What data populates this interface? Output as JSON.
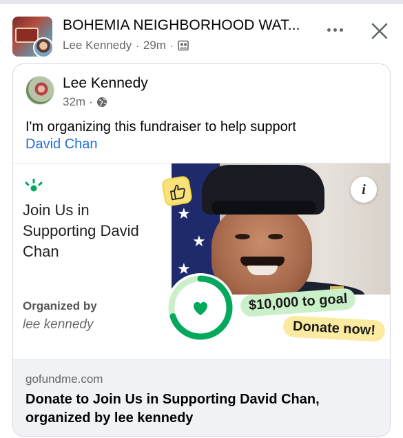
{
  "post": {
    "group_name": "BOHEMIA NEIGHBORHOOD WAT...",
    "poster": "Lee Kennedy",
    "time": "29m",
    "separator": "·"
  },
  "shared": {
    "author": "Lee Kennedy",
    "time": "32m",
    "separator": "·",
    "text": "I'm organizing this fundraiser to help support",
    "mention": "David Chan"
  },
  "fundraiser": {
    "title": "Join Us in Supporting David Chan",
    "organized_label": "Organized by",
    "organizer": "lee kennedy",
    "goal": "$10,000 to goal",
    "cta": "Donate now!",
    "progress": 0.7,
    "info_label": "i"
  },
  "link": {
    "domain": "gofundme.com",
    "title": "Donate to Join Us in Supporting David Chan, organized by lee kennedy"
  },
  "colors": {
    "link_blue": "#216fdb",
    "gfm_green": "#02a95c",
    "goal_green": "#c9f0c8",
    "donate_yellow": "#fbeba0"
  },
  "icons": {
    "members": "members-icon",
    "globe": "globe-icon",
    "more": "more-icon",
    "close": "close-icon",
    "heart": "heart-icon",
    "thumbs_up": "thumbs-up-icon",
    "info": "info-icon",
    "logo": "gofundme-logo-icon"
  }
}
